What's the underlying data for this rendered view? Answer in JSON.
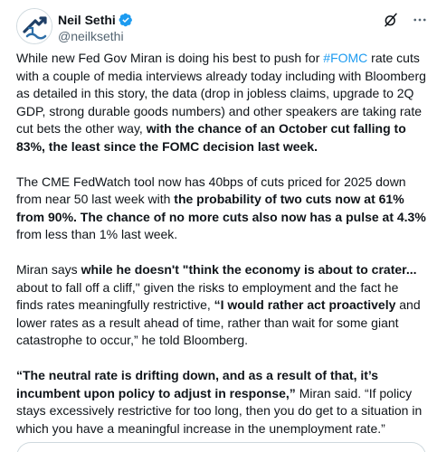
{
  "author": {
    "display_name": "Neil Sethi",
    "handle": "@neilksethi",
    "verified": true,
    "avatar_icon": "stylized-arrow-logo-icon"
  },
  "actions": {
    "grok_icon": "grok-icon",
    "more_icon": "more-options-icon"
  },
  "colors": {
    "link": "#1d9bf0",
    "text": "#0f1419",
    "secondary": "#536471"
  },
  "tweet": {
    "p1": {
      "a": "While new Fed Gov Miran is doing his best to push for ",
      "hashtag": "#FOMC",
      "b": " rate cuts with a couple of media interviews already today including with Bloomberg as detailed in this story, the data (drop in jobless claims, upgrade to 2Q GDP, strong durable goods numbers) and other speakers are taking rate cut bets the other way, ",
      "bold": "with the chance of an October cut falling to 83%, the least since the FOMC decision last week."
    },
    "p2": {
      "a": "The CME FedWatch tool now has 40bps of cuts priced for 2025 down from near 50 last week with ",
      "bold": "the probability of two cuts now at 61% from 90%. The chance of no more cuts also now has a pulse at 4.3%",
      "b": " from less than 1% last week."
    },
    "p3": {
      "a": "Miran says ",
      "bold1": "while he doesn't \"think the economy is about to crater...",
      "b": " about to fall off a cliff,\" given the risks to employment and the fact he finds rates meaningfully restrictive, ",
      "bold2": "“I would rather act proactively",
      "c": " and lower rates as a result ahead of time, rather than wait for some giant catastrophe to occur,” he told Bloomberg."
    },
    "p4": {
      "bold": "“The neutral rate is drifting down, and as a result of that, it’s incumbent upon policy to adjust in response,”",
      "a": " Miran said. “If policy stays excessively restrictive for too long, then you do get to a situation in which you have a meaningful increase in the unemployment rate.”"
    }
  }
}
